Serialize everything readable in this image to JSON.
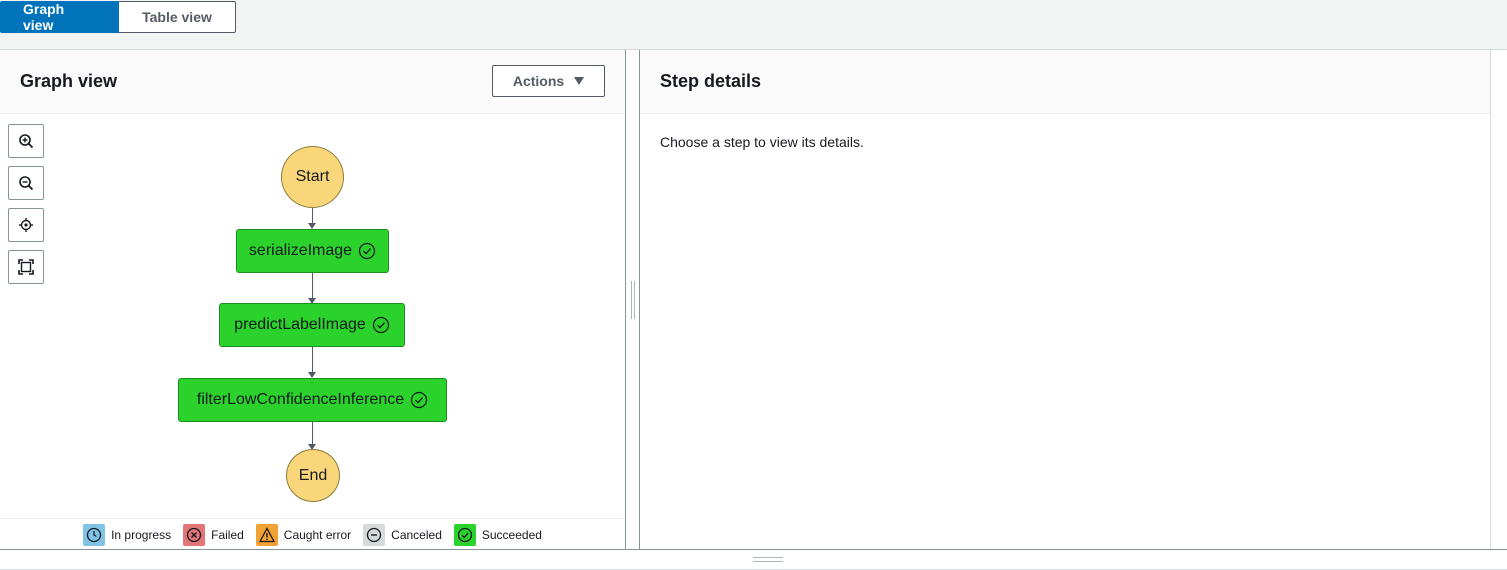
{
  "tabs": {
    "graph_view": "Graph view",
    "table_view": "Table view"
  },
  "left_panel": {
    "title": "Graph view",
    "actions_label": "Actions"
  },
  "graph": {
    "start": "Start",
    "end": "End",
    "states": [
      {
        "name": "serializeImage",
        "status": "Succeeded"
      },
      {
        "name": "predictLabelImage",
        "status": "Succeeded"
      },
      {
        "name": "filterLowConfidenceInference",
        "status": "Succeeded"
      }
    ]
  },
  "legend": {
    "in_progress": "In progress",
    "failed": "Failed",
    "caught_error": "Caught error",
    "canceled": "Canceled",
    "succeeded": "Succeeded"
  },
  "right_panel": {
    "title": "Step details",
    "placeholder": "Choose a step to view its details."
  },
  "colors": {
    "accent": "#0073bb",
    "succeeded": "#2bd22b",
    "start_end": "#fad67a",
    "in_progress": "#7fc3e6",
    "failed": "#e27676",
    "caught_error": "#f2a134",
    "canceled": "#d5dbdb"
  },
  "icons": {
    "zoom_in": "zoom-in-icon",
    "zoom_out": "zoom-out-icon",
    "center": "center-icon",
    "fit": "fit-icon"
  }
}
